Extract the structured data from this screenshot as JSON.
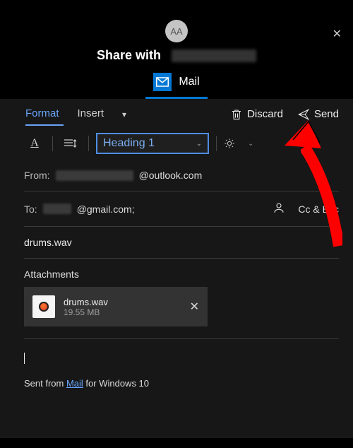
{
  "window": {
    "avatar_initials": "AA",
    "share_prefix": "Share with",
    "app_label": "Mail"
  },
  "tabs": {
    "format": "Format",
    "insert": "Insert"
  },
  "actions": {
    "discard": "Discard",
    "send": "Send"
  },
  "toolbar": {
    "style_value": "Heading 1"
  },
  "fields": {
    "from_label": "From:",
    "from_domain": "@outlook.com",
    "to_label": "To:",
    "to_domain": "@gmail.com;",
    "ccbcc": "Cc & Bcc",
    "subject": "drums.wav",
    "attachments_label": "Attachments"
  },
  "attachment": {
    "name": "drums.wav",
    "size": "19.55 MB"
  },
  "signature": {
    "prefix": "Sent from ",
    "link": "Mail",
    "suffix": " for Windows 10"
  }
}
